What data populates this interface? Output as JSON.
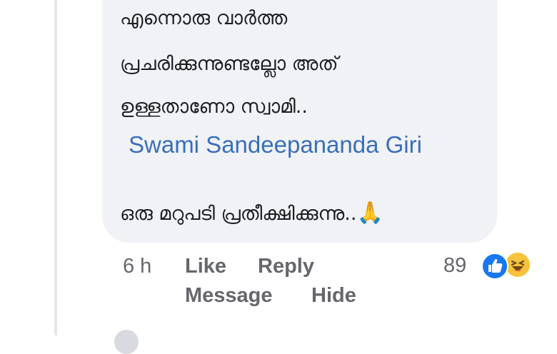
{
  "comment": {
    "lines": [
      "എന്നൊരു വാർത്ത",
      "പ്രചരിക്കുന്നുണ്ടല്ലോ അത്",
      "ഉള്ളതാണോ സ്വാമി.."
    ],
    "mention": "Swami Sandeepananda Giri",
    "closing": "ഒരു മറുപടി പ്രതീക്ഷിക്കുന്നു..",
    "emoji": "🙏"
  },
  "actions": {
    "time": "6 h",
    "like": "Like",
    "reply": "Reply",
    "message": "Message",
    "hide": "Hide"
  },
  "reactions": {
    "count": "89",
    "icons": [
      "like-icon",
      "haha-icon"
    ],
    "colors": {
      "like": "#1877f2",
      "haha": "#f7c33b"
    }
  },
  "colors": {
    "bubble": "#f0f2f5",
    "mention": "#3a6fb8",
    "secondary": "#65676b"
  }
}
